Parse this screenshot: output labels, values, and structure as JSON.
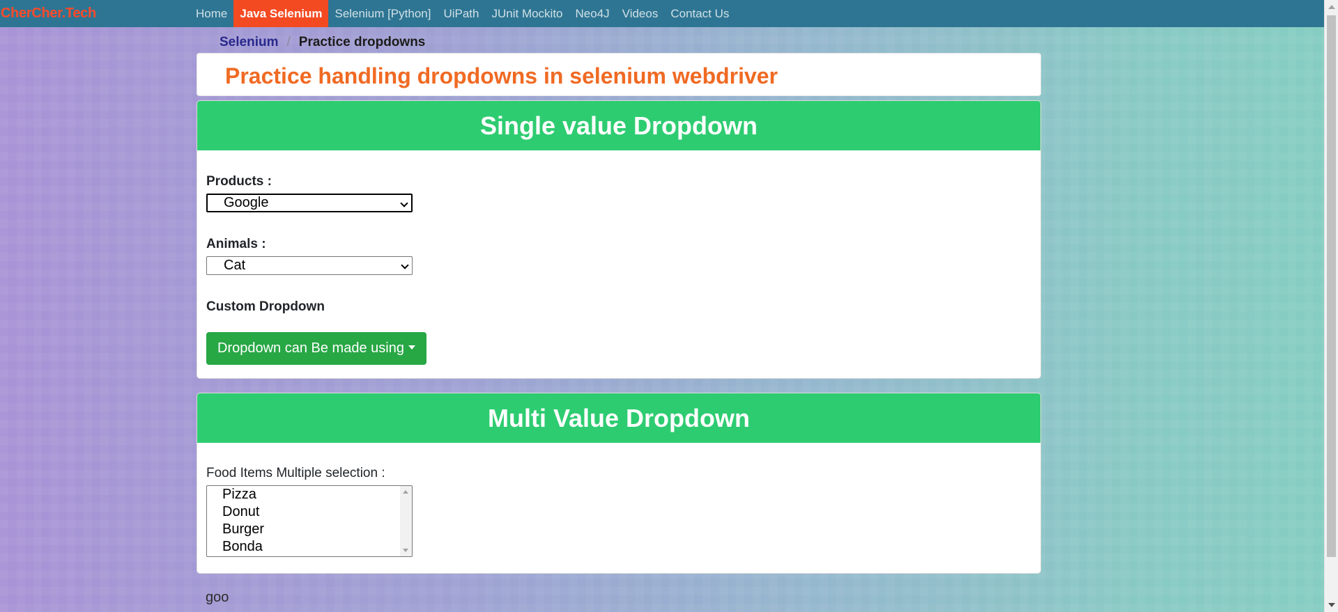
{
  "nav": {
    "brand": "CherCher.Tech",
    "links": [
      "Home",
      "Java Selenium",
      "Selenium [Python]",
      "UiPath",
      "JUnit Mockito",
      "Neo4J",
      "Videos",
      "Contact Us"
    ],
    "active": "Java Selenium"
  },
  "breadcrumb": {
    "parent": "Selenium",
    "separator": "/",
    "current": "Practice dropdowns"
  },
  "page": {
    "title": "Practice handling dropdowns in selenium webdriver"
  },
  "single": {
    "header": "Single value Dropdown",
    "products_label": "Products :",
    "products_value": "Google",
    "animals_label": "Animals :",
    "animals_value": "Cat",
    "custom_label": "Custom Dropdown",
    "custom_button": "Dropdown can Be made using"
  },
  "multi": {
    "header": "Multi Value Dropdown",
    "food_label": "Food Items Multiple selection :",
    "food_options": [
      "Pizza",
      "Donut",
      "Burger",
      "Bonda"
    ]
  },
  "footer": {
    "text": "goo"
  },
  "colors": {
    "nav_bg": "#2e7593",
    "active_tab": "#f44a22",
    "brand": "#ff4a2a",
    "title": "#f06a23",
    "card_header": "#2ecc71",
    "button": "#28a745"
  }
}
